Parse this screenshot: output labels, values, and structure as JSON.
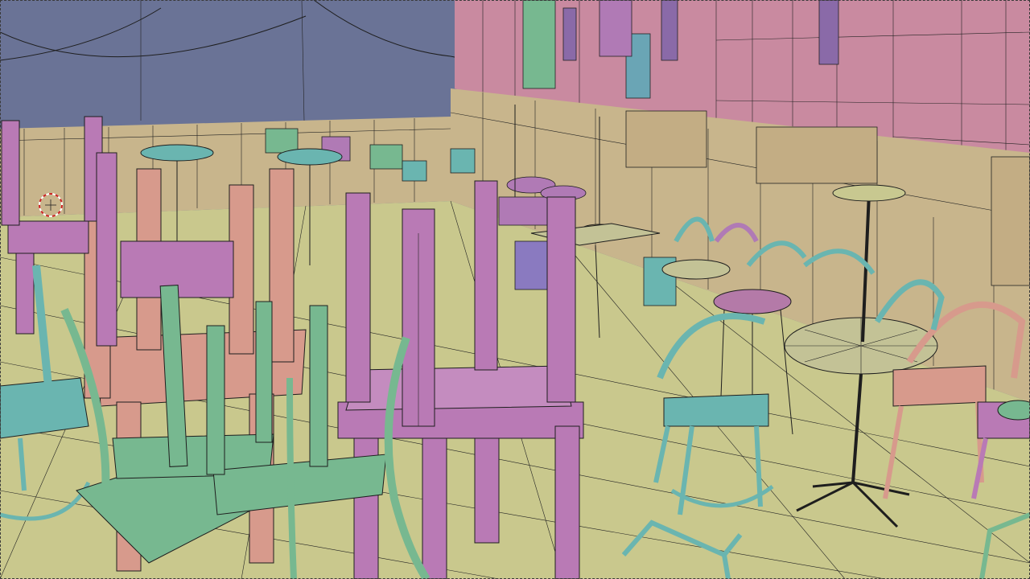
{
  "viewport": {
    "render_mode": "wireframe-on-shaded",
    "colors": {
      "sky": "#6a7396",
      "floor": "#c9c88d",
      "wall_pink": "#c98aa0",
      "wainscot": "#c8b58c",
      "chair_pink": "#b97ab5",
      "chair_green": "#77b890",
      "chair_teal": "#6ab5b0",
      "chair_salmon": "#d79a8c",
      "table_top": "#c3c296",
      "stool_top": "#b47aa8",
      "wire": "#1e1e1e",
      "cursor": "#cc2222"
    },
    "cursor_icon": "3d-cursor-icon"
  }
}
